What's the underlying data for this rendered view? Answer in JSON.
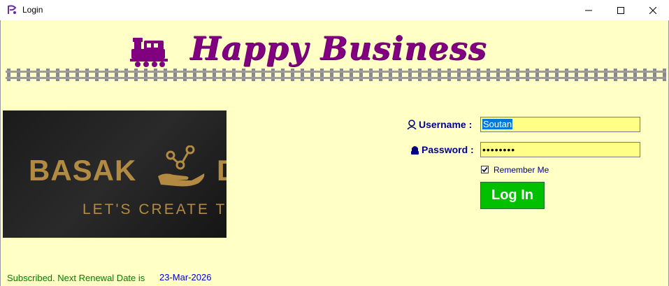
{
  "window": {
    "title": "Login",
    "minimize_icon": "minimize-icon",
    "maximize_icon": "maximize-icon",
    "close_icon": "close-icon"
  },
  "banner": {
    "title": "Happy Business",
    "title_color": "#800080",
    "icon": "train-engine-icon"
  },
  "logo": {
    "word": "BASAK",
    "trailing_letter": "D",
    "tagline": "LET'S CREATE T",
    "gold_color": "#b38a42"
  },
  "form": {
    "username_label": "Username :",
    "username_value": "Soutan",
    "password_label": "Password :",
    "password_value": "••••••••",
    "remember_label": "Remember Me",
    "remember_checked": true,
    "login_label": "Log In",
    "field_color": "#ffff88",
    "button_color": "#00c000"
  },
  "status": {
    "subscription_text": "Subscribed. Next Renewal Date is",
    "renewal_date": "23-Mar-2026"
  },
  "colors": {
    "background": "#ffffc6",
    "label_color": "#00008b"
  }
}
